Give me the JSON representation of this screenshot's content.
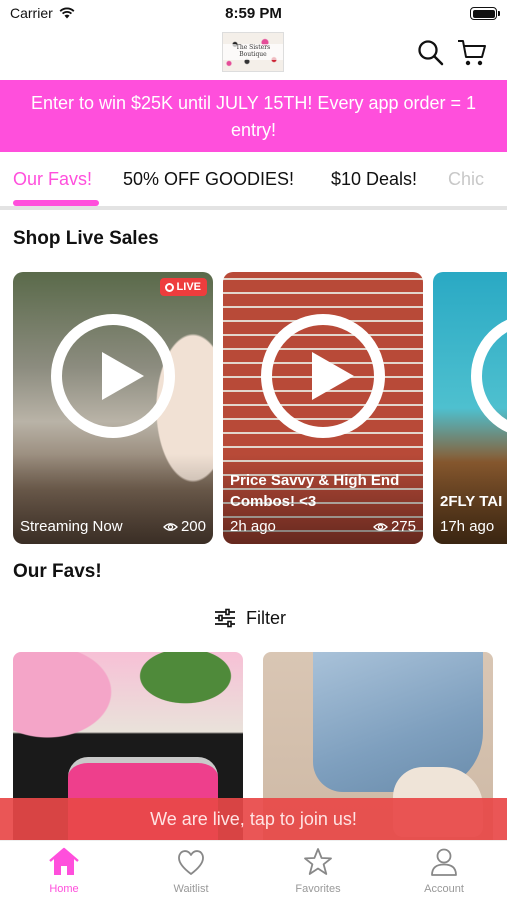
{
  "status_bar": {
    "carrier": "Carrier",
    "time": "8:59 PM"
  },
  "header": {
    "logo_text": "The Sisters Boutique"
  },
  "promo": {
    "text": "Enter to win $25K until JULY 15TH! Every app order = 1 entry!"
  },
  "tabs": [
    {
      "label": "Our Favs!",
      "active": true
    },
    {
      "label": "50% OFF GOODIES!"
    },
    {
      "label": "$10 Deals!"
    },
    {
      "label": "Chic"
    }
  ],
  "live_section": {
    "title": "Shop Live Sales"
  },
  "live_cards": [
    {
      "badge": "LIVE",
      "title": "",
      "time": "Streaming Now",
      "views": "200"
    },
    {
      "title": "Price Savvy & High End Combos! <3",
      "time": "2h ago",
      "views": "275"
    },
    {
      "title": "2FLY TAI",
      "time": "17h ago",
      "views": ""
    }
  ],
  "favs_section": {
    "title": "Our Favs!"
  },
  "filter": {
    "label": "Filter"
  },
  "live_bar": {
    "text": "We are live, tap to join us!"
  },
  "bottom_nav": [
    {
      "label": "Home",
      "icon": "home-icon",
      "active": true
    },
    {
      "label": "Waitlist",
      "icon": "heart-icon"
    },
    {
      "label": "Favorites",
      "icon": "star-icon"
    },
    {
      "label": "Account",
      "icon": "account-icon"
    }
  ],
  "colors": {
    "accent": "#ff4fdc",
    "live_red": "#ee3d3d",
    "live_bar": "#e84848"
  }
}
